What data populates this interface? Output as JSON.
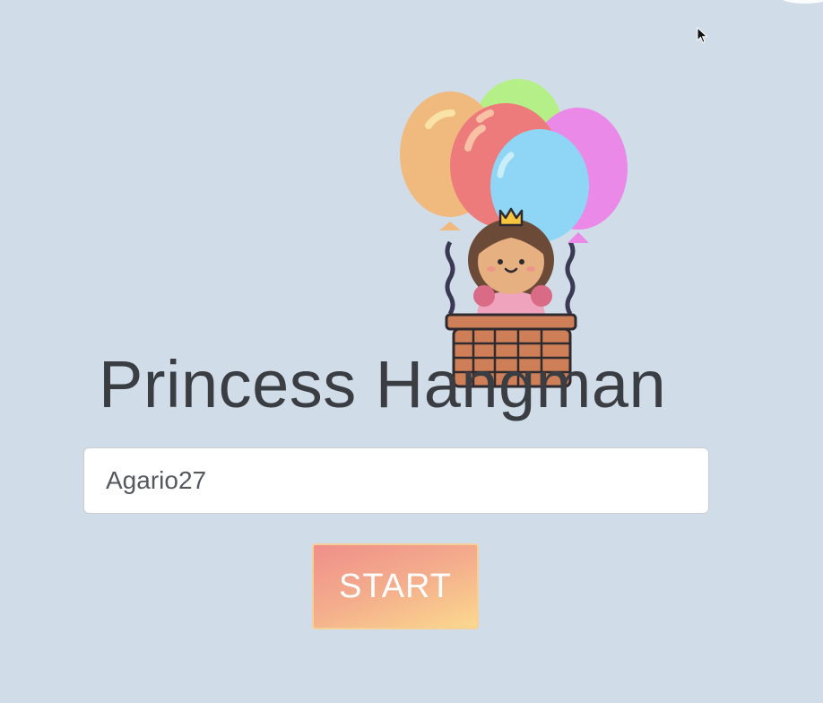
{
  "title": "Princess Hangman",
  "name_input": {
    "value": "Agario27",
    "placeholder": ""
  },
  "start_button": {
    "label": "START"
  },
  "illustration": {
    "icon": "princess-hot-air-balloon-illustration"
  },
  "colors": {
    "background": "#d0dde9",
    "title": "#3a3d42",
    "button_gradient_start": "#ef8f8a",
    "button_gradient_end": "#fbd98e",
    "button_text": "#ffffff"
  }
}
